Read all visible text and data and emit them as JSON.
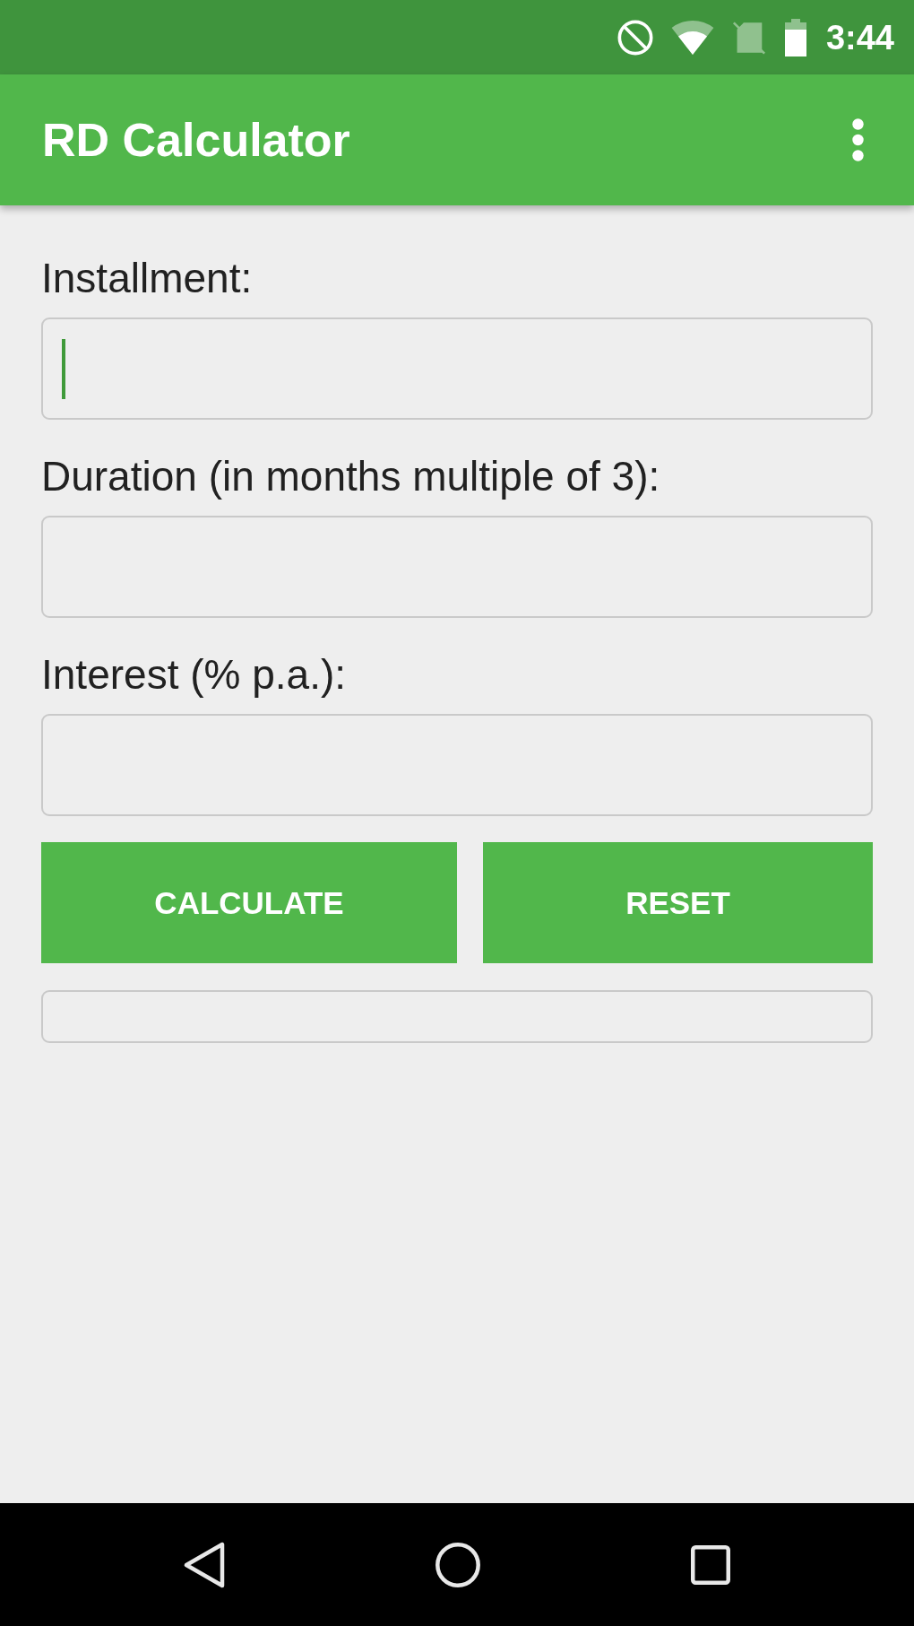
{
  "status_bar": {
    "time": "3:44"
  },
  "app_bar": {
    "title": "RD Calculator"
  },
  "form": {
    "fields": [
      {
        "label": "Installment:",
        "focused": true
      },
      {
        "label": "Duration (in months multiple of 3):",
        "focused": false
      },
      {
        "label": "Interest (% p.a.):",
        "focused": false
      }
    ]
  },
  "buttons": [
    {
      "label": "CALCULATE"
    },
    {
      "label": "RESET"
    }
  ]
}
